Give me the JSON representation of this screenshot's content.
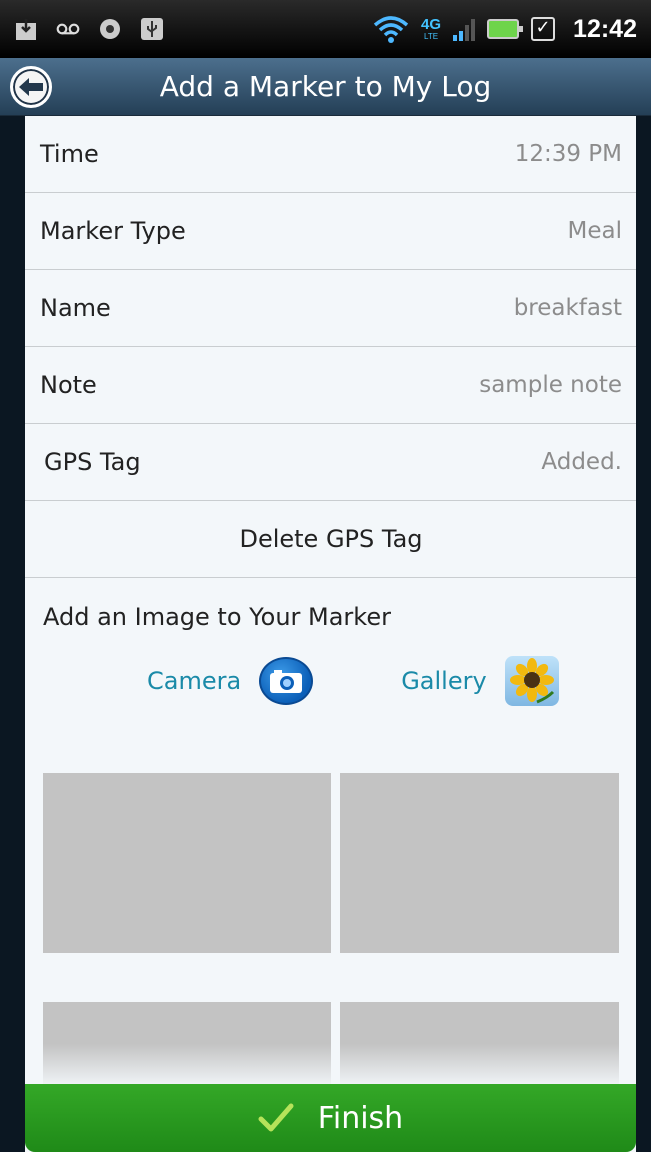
{
  "status_bar": {
    "network": "4G",
    "network_sub": "LTE",
    "time": "12:42",
    "icons": [
      "download-icon",
      "voicemail-icon",
      "record-icon",
      "usb-icon",
      "wifi-icon",
      "signal-icon",
      "battery-charging-icon",
      "checkbox-icon"
    ]
  },
  "title_bar": {
    "title": "Add a Marker to My Log",
    "back_icon": "back-arrow-icon"
  },
  "form": {
    "rows": [
      {
        "label": "Time",
        "value": "12:39 PM"
      },
      {
        "label": "Marker Type",
        "value": "Meal"
      },
      {
        "label": "Name",
        "value": "breakfast"
      },
      {
        "label": "Note",
        "value": "sample note"
      },
      {
        "label": "GPS Tag",
        "value": "Added."
      }
    ],
    "delete_gps_label": "Delete GPS Tag"
  },
  "image_section": {
    "title": "Add an Image to Your Marker",
    "camera_label": "Camera",
    "gallery_label": "Gallery",
    "camera_icon": "camera-icon",
    "gallery_icon": "sunflower-gallery-icon"
  },
  "finish": {
    "label": "Finish",
    "icon": "checkmark-icon",
    "color": "#2a9a20"
  },
  "colors": {
    "link_teal": "#1a8aa8",
    "title_bar": "#35546f",
    "thumb_placeholder": "#c3c3c3"
  }
}
